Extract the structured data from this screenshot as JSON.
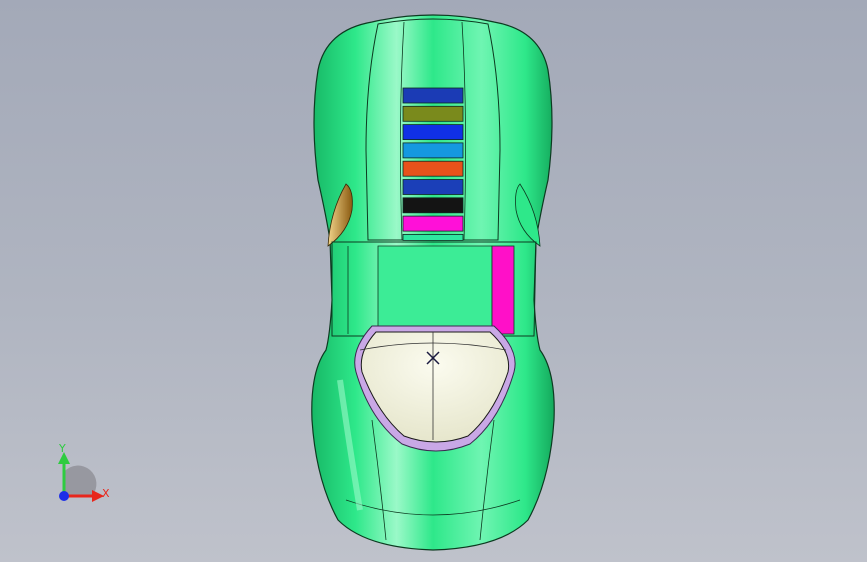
{
  "viewport": {
    "background_top": "#a3a9b8",
    "background_bottom": "#bfc2cb"
  },
  "model": {
    "body_color": "#2ee88a",
    "body_highlight": "#7cf7bb",
    "body_shadow": "#17b866",
    "windshield_color": "#f1f1dc",
    "windshield_trim_color": "#c9a8e6",
    "side_panel_color": "#ff10c8",
    "mirror_color": "#b8872a",
    "vent_slats": [
      {
        "color": "#1b3bb5"
      },
      {
        "color": "#7a8a1c"
      },
      {
        "color": "#1030e6"
      },
      {
        "color": "#1598e0"
      },
      {
        "color": "#e8521b"
      },
      {
        "color": "#1b3fb8"
      },
      {
        "color": "#141414"
      },
      {
        "color": "#ff10d8"
      },
      {
        "color": "#2ee8a0"
      }
    ]
  },
  "triad": {
    "y_label": "Y",
    "x_label": "X",
    "y_color": "#2ecc40",
    "x_color": "#e8261c",
    "z_color": "#1c2ee8"
  }
}
